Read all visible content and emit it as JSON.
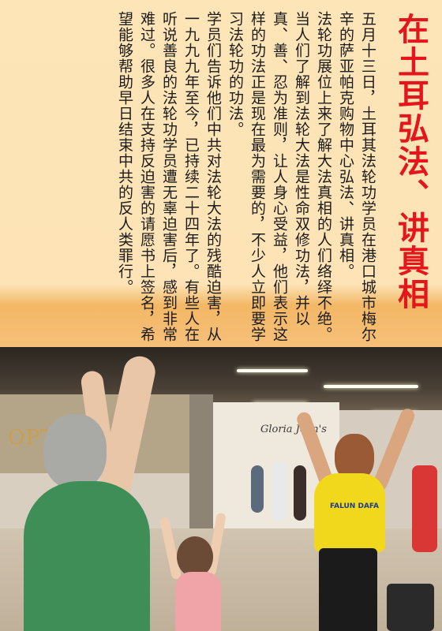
{
  "article": {
    "title": "在土耳弘法、讲真相",
    "paragraphs": [
      "五月十三日，土耳其法轮功学员在港口城市梅尔辛的萨亚帕克购物中心弘法、讲真相。",
      "法轮功展位上来了解大法真相的人们络绎不绝。",
      "当人们了解到法轮大法是性命双修功法，并以真、善、忍为准则，让人身心受益，他们表示这样的功法正是现在最为需要的，不少人立即要学习法轮功的功法。",
      "学员们告诉他们中共对法轮大法的残酷迫害，从一九九九年至今，已持续二十四年了。有些人在听说善良的法轮功学员遭无辜迫害后，感到非常难过。很多人在支持反迫害的请愿书上签名，希望能够帮助早日结束中共的反人类罪行。"
    ]
  },
  "photo": {
    "store_sign": "OPTICAL",
    "store_mid_sign": "Gloria Jean's",
    "shirt_label": "FALUN DAFA"
  },
  "colors": {
    "title": "#e5161b",
    "panel_background": "#fde5b8",
    "body_text": "#1c1c1c"
  }
}
